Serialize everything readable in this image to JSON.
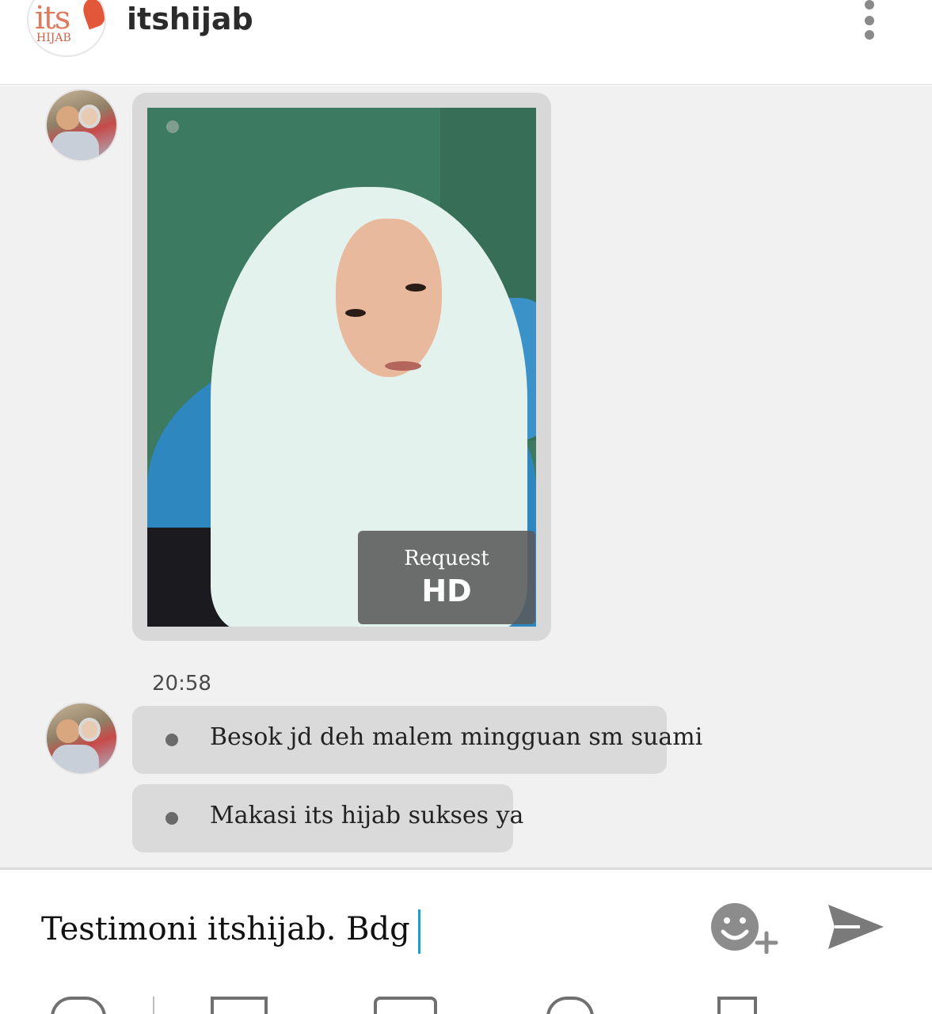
{
  "header": {
    "logo_its": "its",
    "logo_hijab": "HIJAB",
    "title": "itshijab",
    "menu_icon": "more-vertical-icon"
  },
  "messages": {
    "photo": {
      "request_label": "Request",
      "hd_label": "HD"
    },
    "timestamp": "20:58",
    "texts": [
      "Besok jd deh malem mingguan sm suami",
      "Makasi its hijab sukses ya"
    ]
  },
  "composer": {
    "value": "Testimoni itshijab. Bdg",
    "emoji_icon": "emoji-add-icon",
    "send_icon": "send-icon"
  },
  "toolbar": {
    "icons": [
      "timer-icon",
      "image-icon",
      "camera-icon",
      "refresh-icon",
      "file-icon"
    ]
  }
}
